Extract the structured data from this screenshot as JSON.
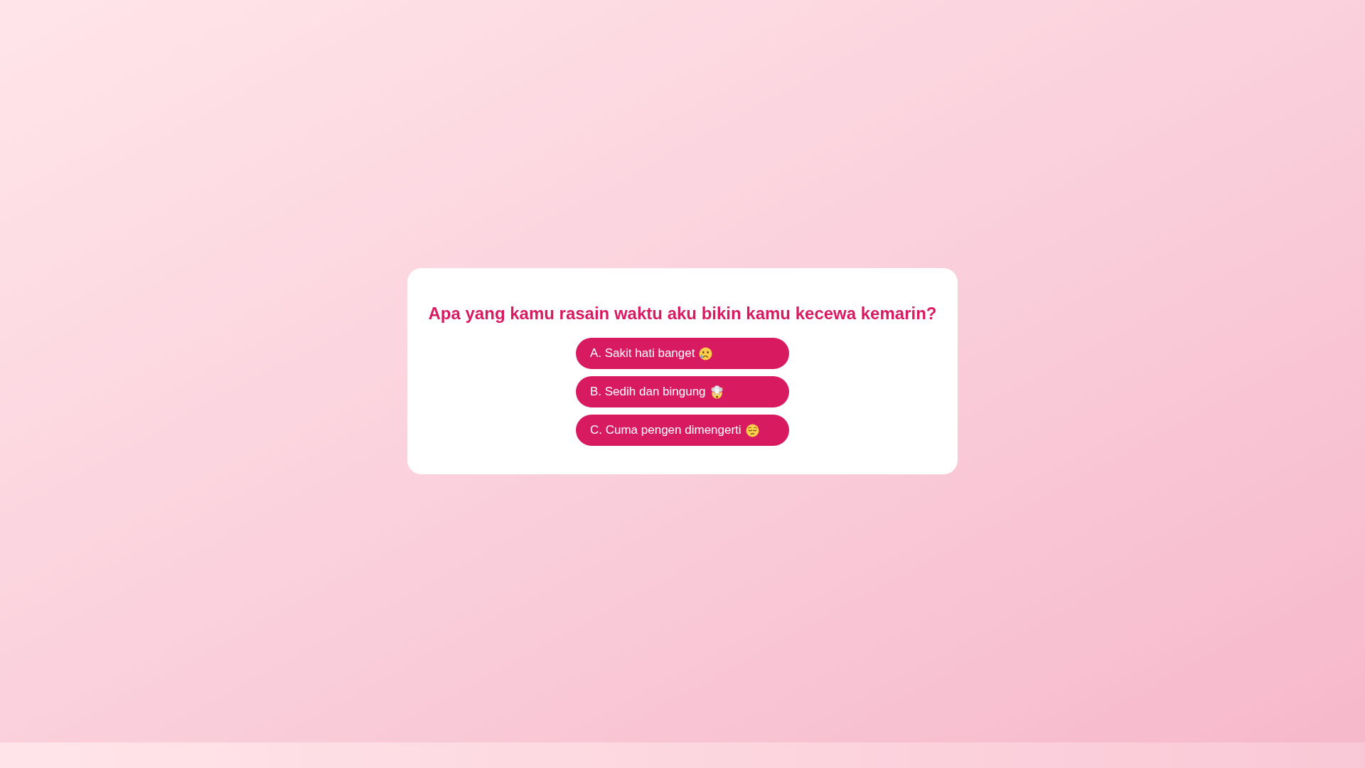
{
  "card": {
    "title": "Apa yang kamu rasain waktu aku bikin kamu kecewa kemarin?",
    "options": [
      {
        "label": "A. Sakit hati banget"
      },
      {
        "label": "B. Sedih dan bingung"
      },
      {
        "label": "C. Cuma pengen dimengerti"
      }
    ]
  }
}
